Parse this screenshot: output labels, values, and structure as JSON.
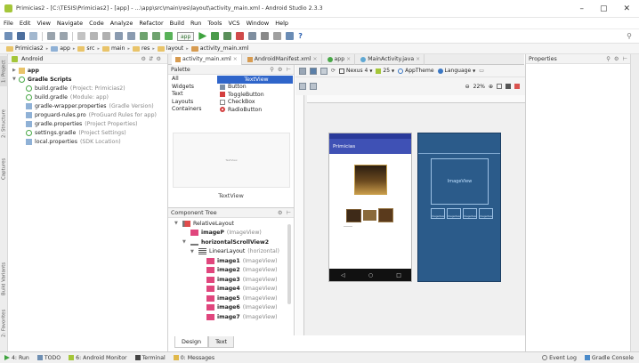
{
  "window": {
    "title": "Primicias2 - [C:\\TESIS\\Primicias2] - [app] - ...\\app\\src\\main\\res\\layout\\activity_main.xml - Android Studio 2.3.3",
    "controls": [
      "–",
      "▢",
      "✕"
    ]
  },
  "menu": [
    "File",
    "Edit",
    "View",
    "Navigate",
    "Code",
    "Analyze",
    "Refactor",
    "Build",
    "Run",
    "Tools",
    "VCS",
    "Window",
    "Help"
  ],
  "toolbar": {
    "run_config": "app",
    "help": "?"
  },
  "breadcrumb": [
    "Primicias2",
    "app",
    "src",
    "main",
    "res",
    "layout",
    "activity_main.xml"
  ],
  "left_tabs": [
    "1: Project",
    "2: Structure",
    "Captures",
    "Build Variants",
    "2: Favorites"
  ],
  "project": {
    "view": "Android",
    "items": [
      {
        "label": "app",
        "sub": "",
        "indent": 0,
        "kind": "folder"
      },
      {
        "label": "Gradle Scripts",
        "sub": "",
        "indent": 0,
        "kind": "gradle"
      },
      {
        "label": "build.gradle",
        "sub": "(Project: Primicias2)",
        "indent": 1,
        "kind": "gradle"
      },
      {
        "label": "build.gradle",
        "sub": "(Module: app)",
        "indent": 1,
        "kind": "gradle"
      },
      {
        "label": "gradle-wrapper.properties",
        "sub": "(Gradle Version)",
        "indent": 1,
        "kind": "file"
      },
      {
        "label": "proguard-rules.pro",
        "sub": "(ProGuard Rules for app)",
        "indent": 1,
        "kind": "file"
      },
      {
        "label": "gradle.properties",
        "sub": "(Project Properties)",
        "indent": 1,
        "kind": "file"
      },
      {
        "label": "settings.gradle",
        "sub": "(Project Settings)",
        "indent": 1,
        "kind": "gradle"
      },
      {
        "label": "local.properties",
        "sub": "(SDK Location)",
        "indent": 1,
        "kind": "file"
      }
    ]
  },
  "editor_tabs": [
    {
      "label": "activity_main.xml",
      "active": true
    },
    {
      "label": "AndroidManifest.xml",
      "active": false
    },
    {
      "label": "app",
      "active": false
    },
    {
      "label": "MainActivity.java",
      "active": false
    }
  ],
  "palette": {
    "title": "Palette",
    "categories": [
      "All",
      "Widgets",
      "Text",
      "Layouts",
      "Containers"
    ],
    "items": [
      "TextView",
      "Button",
      "ToggleButton",
      "CheckBox",
      "RadioButton"
    ],
    "preview_text": "TextView",
    "footer": "TextView"
  },
  "design_toolbar": {
    "device": "Nexus 4",
    "api": "25",
    "theme": "AppTheme",
    "language": "Language",
    "zoom": "22%"
  },
  "component_tree": {
    "title": "Component Tree",
    "items": [
      {
        "label": "RelativeLayout",
        "hint": "",
        "indent": 0,
        "bold": false
      },
      {
        "label": "imageP",
        "hint": "(ImageView)",
        "indent": 1,
        "bold": true
      },
      {
        "label": "horizontalScrollView2",
        "hint": "",
        "indent": 1,
        "bold": true
      },
      {
        "label": "LinearLayout",
        "hint": "(horizontal)",
        "indent": 2,
        "bold": false
      },
      {
        "label": "image1",
        "hint": "(ImageView)",
        "indent": 3,
        "bold": true
      },
      {
        "label": "image2",
        "hint": "(ImageView)",
        "indent": 3,
        "bold": true
      },
      {
        "label": "image3",
        "hint": "(ImageView)",
        "indent": 3,
        "bold": true
      },
      {
        "label": "image4",
        "hint": "(ImageView)",
        "indent": 3,
        "bold": true
      },
      {
        "label": "image5",
        "hint": "(ImageView)",
        "indent": 3,
        "bold": true
      },
      {
        "label": "image6",
        "hint": "(ImageView)",
        "indent": 3,
        "bold": true
      },
      {
        "label": "image7",
        "hint": "(ImageView)",
        "indent": 3,
        "bold": true
      }
    ]
  },
  "bottom_tabs": [
    "Design",
    "Text"
  ],
  "phone": {
    "app_title": "Primicias"
  },
  "blueprint": {
    "image_label": "ImageView",
    "small_label": "ImageView"
  },
  "properties": {
    "title": "Properties"
  },
  "status_bar": {
    "left": [
      "4: Run",
      "TODO",
      "6: Android Monitor",
      "Terminal",
      "0: Messages"
    ],
    "right": [
      "Event Log",
      "Gradle Console"
    ]
  },
  "colors": {
    "accent": "#3f51b5",
    "blueprint": "#2b5b8a",
    "selection": "#2f65ca"
  }
}
